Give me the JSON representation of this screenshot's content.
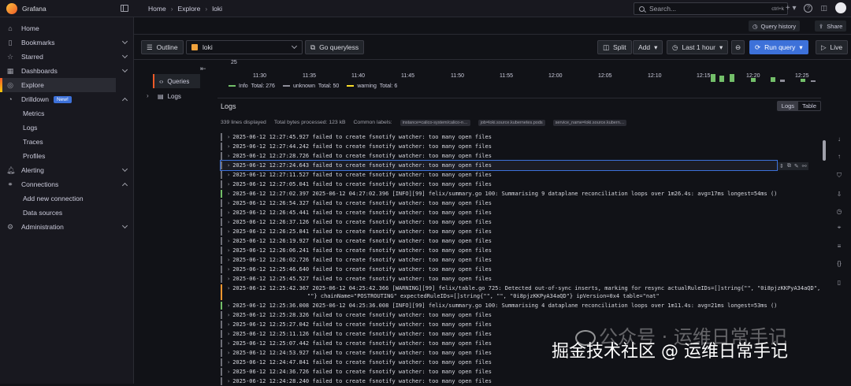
{
  "app": {
    "brand": "Grafana"
  },
  "breadcrumbs": [
    "Home",
    "Explore",
    "loki"
  ],
  "search": {
    "placeholder": "Search...",
    "shortcut": "ctrl+k"
  },
  "sidebar": {
    "items": [
      {
        "label": "Home",
        "icon": "home-icon"
      },
      {
        "label": "Bookmarks",
        "icon": "bookmark-icon"
      },
      {
        "label": "Starred",
        "icon": "star-icon"
      },
      {
        "label": "Dashboards",
        "icon": "dashboard-icon"
      },
      {
        "label": "Explore",
        "icon": "compass-icon"
      },
      {
        "label": "Drilldown",
        "icon": "drilldown-icon",
        "badge": "New!"
      }
    ],
    "drilldown_sub": [
      "Metrics",
      "Logs",
      "Traces",
      "Profiles"
    ],
    "alerting": "Alerting",
    "connections": "Connections",
    "connections_sub": [
      "Add new connection",
      "Data sources"
    ],
    "administration": "Administration"
  },
  "page_toolbar": {
    "query_history": "Query history",
    "share": "Share"
  },
  "explore": {
    "outline": "Outline",
    "datasource": "loki",
    "go_queryless": "Go queryless",
    "split": "Split",
    "add": "Add",
    "time_range": "Last 1 hour",
    "run_query": "Run query",
    "live": "Live"
  },
  "content_outline": {
    "queries": "Queries",
    "logs": "Logs"
  },
  "graph": {
    "y_label": "25",
    "ticks": [
      "11:30",
      "11:35",
      "11:40",
      "11:45",
      "11:50",
      "11:55",
      "12:00",
      "12:05",
      "12:10",
      "12:15",
      "12:20",
      "12:25"
    ],
    "legend": [
      {
        "name": "Info",
        "total": "Total: 276",
        "color": "#73bf69"
      },
      {
        "name": "unknown",
        "total": "Total: 50",
        "color": "#8e8e99"
      },
      {
        "name": "warning",
        "total": "Total: 6",
        "color": "#fade2a"
      }
    ]
  },
  "logs": {
    "title": "Logs",
    "view_logs": "Logs",
    "view_table": "Table",
    "lines_displayed": "339 lines displayed",
    "bytes_processed": "Total bytes processed: 123 kB",
    "common_labels": "Common labels:",
    "label_chips": [
      "instance=calico-system/calico-n…",
      "job=loki.source.kubernetes.pods",
      "service_name=loki.source.kubern…"
    ],
    "rows": [
      {
        "level": "unknown",
        "text": "2025-06-12 12:27:45.927 failed to create fsnotify watcher: too many open files"
      },
      {
        "level": "unknown",
        "text": "2025-06-12 12:27:44.242 failed to create fsnotify watcher: too many open files"
      },
      {
        "level": "unknown",
        "text": "2025-06-12 12:27:28.726 failed to create fsnotify watcher: too many open files"
      },
      {
        "level": "unknown",
        "text": "2025-06-12 12:27:24.643 failed to create fsnotify watcher: too many open files",
        "hover": true
      },
      {
        "level": "unknown",
        "text": "2025-06-12 12:27:11.527 failed to create fsnotify watcher: too many open files"
      },
      {
        "level": "unknown",
        "text": "2025-06-12 12:27:05.041 failed to create fsnotify watcher: too many open files"
      },
      {
        "level": "info",
        "text": "2025-06-12 12:27:02.397 2025-06-12 04:27:02.396 [INFO][99] felix/summary.go 100: Summarising 9 dataplane reconciliation loops over 1m26.4s: avg=17ms longest=54ms ()"
      },
      {
        "level": "unknown",
        "text": "2025-06-12 12:26:54.327 failed to create fsnotify watcher: too many open files"
      },
      {
        "level": "unknown",
        "text": "2025-06-12 12:26:45.441 failed to create fsnotify watcher: too many open files"
      },
      {
        "level": "unknown",
        "text": "2025-06-12 12:26:37.126 failed to create fsnotify watcher: too many open files"
      },
      {
        "level": "unknown",
        "text": "2025-06-12 12:26:25.841 failed to create fsnotify watcher: too many open files"
      },
      {
        "level": "unknown",
        "text": "2025-06-12 12:26:19.927 failed to create fsnotify watcher: too many open files"
      },
      {
        "level": "unknown",
        "text": "2025-06-12 12:26:06.241 failed to create fsnotify watcher: too many open files"
      },
      {
        "level": "unknown",
        "text": "2025-06-12 12:26:02.726 failed to create fsnotify watcher: too many open files"
      },
      {
        "level": "unknown",
        "text": "2025-06-12 12:25:46.640 failed to create fsnotify watcher: too many open files"
      },
      {
        "level": "unknown",
        "text": "2025-06-12 12:25:45.527 failed to create fsnotify watcher: too many open files"
      },
      {
        "level": "warn",
        "text": "2025-06-12 12:25:42.367 2025-06-12 04:25:42.366 [WARNING][99] felix/table.go 725: Detected out-of-sync inserts, marking for resync actualRuleIDs=[]string{\"\", \"0i8pjzKKPyA34aQD\",",
        "text2": "\"\"} chainName=\"POSTROUTING\" expectedRuleIDs=[]string{\"\", \"\", \"0i8pjzKKPyA34aQD\"} ipVersion=0x4 table=\"nat\"",
        "tall": true
      },
      {
        "level": "info",
        "text": "2025-06-12 12:25:36.008 2025-06-12 04:25:36.008 [INFO][99] felix/summary.go 100: Summarising 4 dataplane reconciliation loops over 1m11.4s: avg=21ms longest=53ms ()"
      },
      {
        "level": "unknown",
        "text": "2025-06-12 12:25:28.326 failed to create fsnotify watcher: too many open files"
      },
      {
        "level": "unknown",
        "text": "2025-06-12 12:25:27.042 failed to create fsnotify watcher: too many open files"
      },
      {
        "level": "unknown",
        "text": "2025-06-12 12:25:11.126 failed to create fsnotify watcher: too many open files"
      },
      {
        "level": "unknown",
        "text": "2025-06-12 12:25:07.442 failed to create fsnotify watcher: too many open files"
      },
      {
        "level": "unknown",
        "text": "2025-06-12 12:24:53.927 failed to create fsnotify watcher: too many open files"
      },
      {
        "level": "unknown",
        "text": "2025-06-12 12:24:47.841 failed to create fsnotify watcher: too many open files"
      },
      {
        "level": "unknown",
        "text": "2025-06-12 12:24:36.726 failed to create fsnotify watcher: too many open files"
      },
      {
        "level": "unknown",
        "text": "2025-06-12 12:24:28.240 failed to create fsnotify watcher: too many open files"
      }
    ]
  },
  "watermark": {
    "line1": "公众号 · 运维日常手记",
    "line2": "掘金技术社区 @ 运维日常手记"
  }
}
